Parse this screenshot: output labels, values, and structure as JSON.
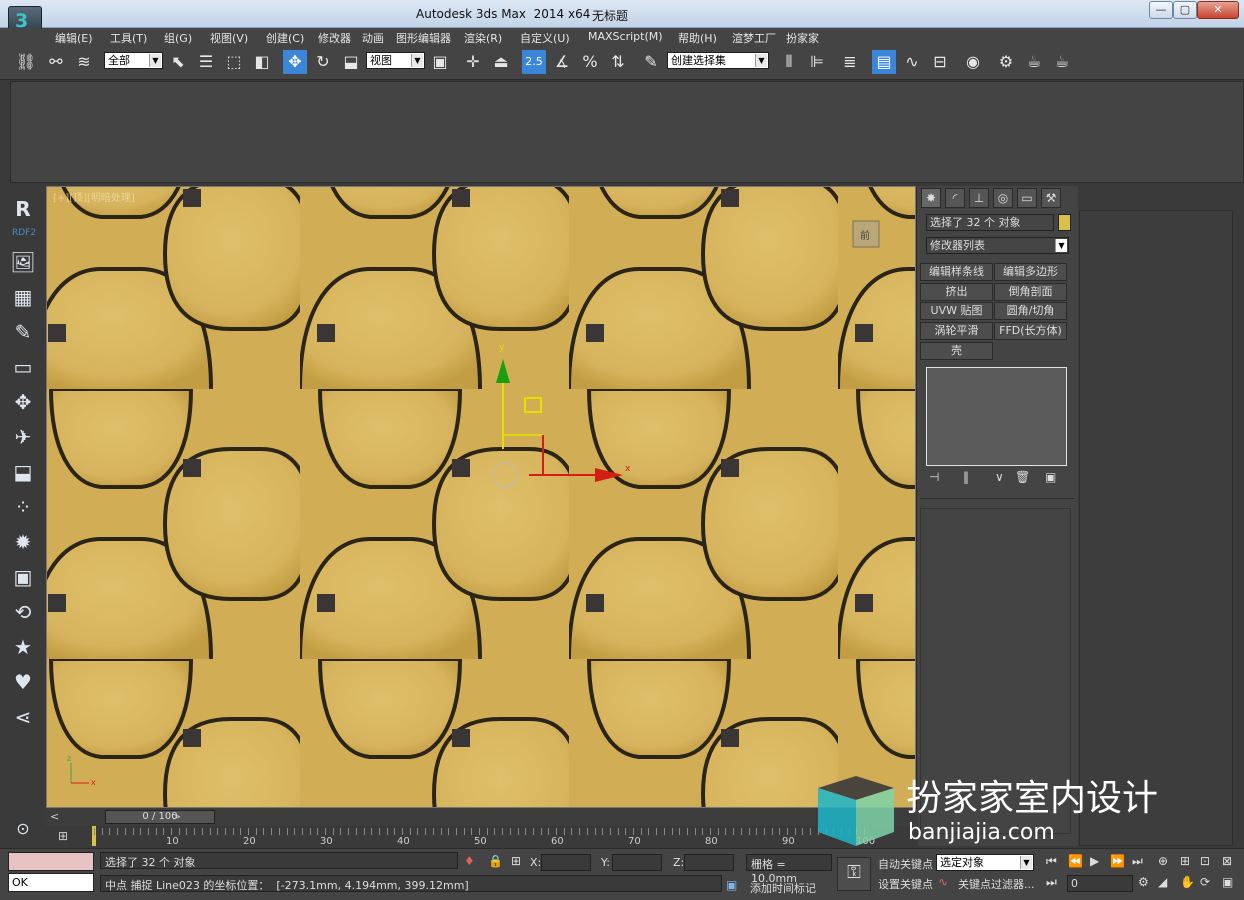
{
  "window": {
    "title": "Autodesk 3ds Max  2014 x64",
    "doc": "无标题",
    "min": "—",
    "max": "▢",
    "close": "✕"
  },
  "menu": [
    "编辑(E)",
    "工具(T)",
    "组(G)",
    "视图(V)",
    "创建(C)",
    "修改器",
    "动画",
    "图形编辑器",
    "渲染(R)",
    "自定义(U)",
    "MAXScript(M)",
    "帮助(H)",
    "渲梦工厂",
    "扮家家"
  ],
  "toolbar": {
    "filter": "全部",
    "coord": "视图",
    "snap_value": "2.5",
    "selection_set": "创建选择集"
  },
  "leftnav": {
    "brand": "R",
    "brand_label": "RDF2",
    "icons": [
      "image-icon",
      "layout-icon",
      "edit-icon",
      "monitor-icon",
      "move-icon",
      "plane-icon",
      "inbox-icon",
      "grid-icon",
      "sun-icon",
      "camera-icon",
      "refresh-icon",
      "star-icon",
      "heart-icon",
      "share-icon",
      "back-icon"
    ]
  },
  "viewport": {
    "label": "[+][顶][明暗处理]",
    "axis_x": "x",
    "axis_y": "y",
    "axis_z": "z",
    "cube_label": "前"
  },
  "panel": {
    "selected": "选择了 32 个 对象",
    "modifier_list": "修改器列表",
    "buttons": [
      "编辑样条线",
      "编辑多边形",
      "挤出",
      "倒角剖面",
      "UVW 贴图",
      "圆角/切角",
      "涡轮平滑",
      "FFD(长方体)",
      "壳"
    ]
  },
  "timeline": {
    "slider": "0 / 100",
    "ticks": [
      "10",
      "20",
      "30",
      "40",
      "50",
      "60",
      "70",
      "80",
      "90",
      "100"
    ]
  },
  "status": {
    "input": "OK",
    "selected": "选择了 32 个 对象",
    "prompt": "中点 捕捉 Line023 的坐标位置：  [-273.1mm, 4.194mm, 399.12mm]",
    "x_label": "X:",
    "y_label": "Y:",
    "z_label": "Z:",
    "grid": "栅格 = 10.0mm",
    "auto_key": "自动关键点",
    "selected_obj": "选定对象",
    "set_key": "设置关键点",
    "key_filter": "关键点过滤器...",
    "add_tag": "添加时间标记",
    "frame": "0"
  },
  "watermark": {
    "cn": "扮家家室内设计",
    "en": "banjiajia.com"
  },
  "colors": {
    "gold": "#d6b45d",
    "accent": "#3b86d8",
    "swatch": "#d8c04a"
  }
}
